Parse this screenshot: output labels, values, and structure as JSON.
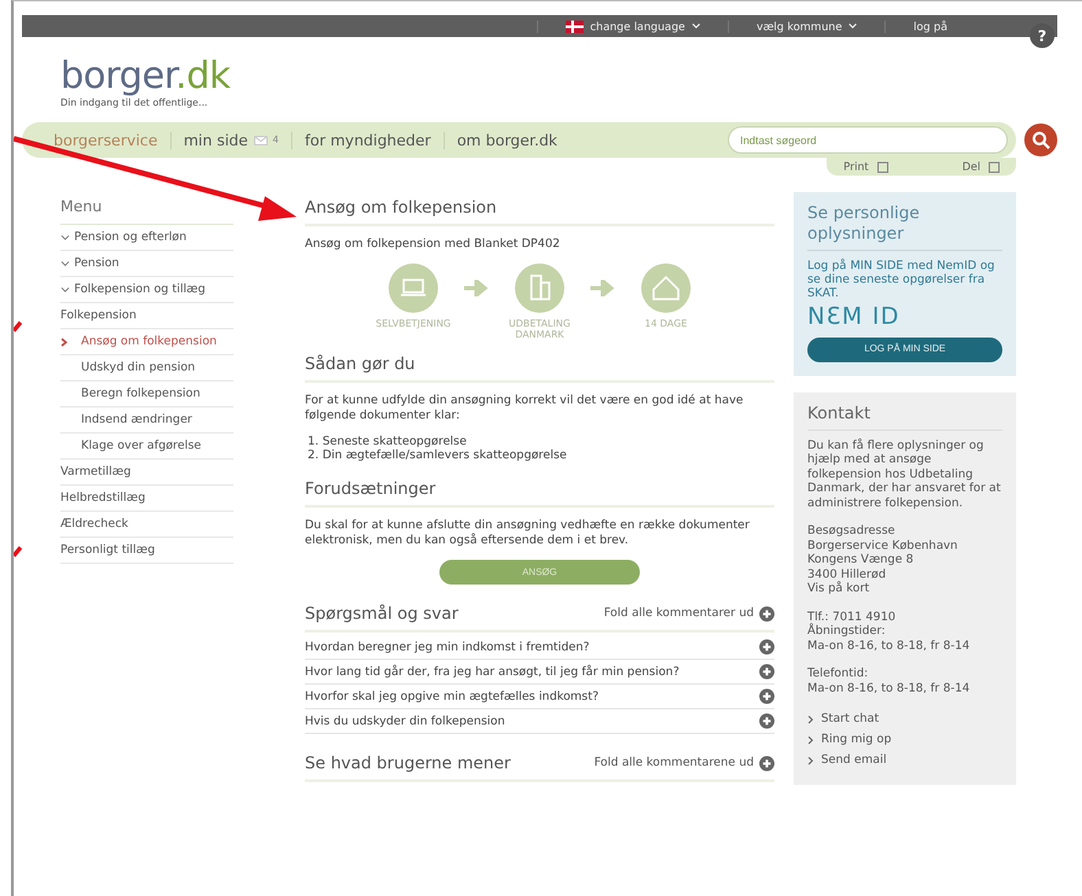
{
  "top_bar": {
    "items": [
      {
        "label": "change language",
        "kind": "flag"
      },
      {
        "label": "vælg kommune",
        "kind": "dropdown"
      },
      {
        "label": "log på",
        "kind": "plain"
      }
    ],
    "help": "?"
  },
  "logo": {
    "text_a": "borger",
    "text_b": ".dk",
    "tagline": "Din indgang til det offentlige..."
  },
  "nav": {
    "items": [
      {
        "label": "borgerservice",
        "selected": true
      },
      {
        "label": "min side",
        "selected": false,
        "badge": "4"
      },
      {
        "label": "for myndigheder",
        "selected": false
      },
      {
        "label": "om borger.dk",
        "selected": false
      }
    ],
    "search": {
      "placeholder": "Indtast søgeord"
    }
  },
  "tools": [
    "Print",
    "Del"
  ],
  "menu": {
    "title": "Menu",
    "items": [
      {
        "label": "Pension og efterløn",
        "kind": "expander",
        "expanded": true
      },
      {
        "label": "Pension",
        "kind": "expander",
        "expanded": true
      },
      {
        "label": "Folkepension og tillæg",
        "kind": "expander",
        "expanded": true
      },
      {
        "label": "Folkepension",
        "kind": "plain",
        "children": [
          {
            "label": "Ansøg om folkepension",
            "selected": true
          },
          {
            "label": "Udskyd din pension",
            "selected": false
          },
          {
            "label": "Beregn folkepension",
            "selected": false
          },
          {
            "label": "Indsend ændringer",
            "selected": false
          },
          {
            "label": "Klage over afgørelse",
            "selected": false
          }
        ]
      },
      {
        "label": "Varmetillæg",
        "kind": "plain"
      },
      {
        "label": "Helbredstillæg",
        "kind": "plain"
      },
      {
        "label": "Ældrecheck",
        "kind": "plain"
      },
      {
        "label": "Personligt tillæg",
        "kind": "plain"
      }
    ]
  },
  "main": {
    "title": "Ansøg om folkepension",
    "intro": "Ansøg om folkepension med Blanket DP402",
    "steps": [
      {
        "label": "SELVBETJENING",
        "kind": "laptop"
      },
      {
        "label": "UDBETALING DANMARK",
        "kind": "building"
      },
      {
        "label": "14 DAGE",
        "kind": "house"
      }
    ],
    "how_title": "Sådan gør du",
    "how_text": "For at kunne udfylde din ansøgning korrekt vil det være en god idé at have følgende dokumenter klar:",
    "how_list": [
      {
        "num": "1.",
        "text": "Seneste skatteopgørelse"
      },
      {
        "num": "2.",
        "text": "Din ægtefælle/samlevers skatteopgørelse"
      }
    ],
    "req_title": "Forudsætninger",
    "req_text": "Du skal for at kunne afslutte din ansøgning vedhæfte en række dokumenter elektronisk, men du kan også eftersende dem i et brev.",
    "apply_button": "ANSØG",
    "faq": {
      "title": "Spørgsmål og svar",
      "fold": "Fold alle kommentarer ud",
      "questions": [
        "Hvordan beregner jeg min indkomst i fremtiden?",
        "Hvor lang tid går der, fra jeg har ansøgt, til jeg får min pension?",
        "Hvorfor skal jeg opgive min ægtefælles indkomst?",
        "Hvis du udskyder din folkepension"
      ]
    },
    "opinions": {
      "title": "Se hvad brugerne mener",
      "fold": "Fold alle kommentarene ud"
    }
  },
  "personal": {
    "title": "Se personlige oplysninger",
    "text": "Log på MIN SIDE med NemID og se dine seneste opgørelser fra SKAT.",
    "nemid": "NƐM ID",
    "button": "LOG PÅ MIN SIDE"
  },
  "contact": {
    "title": "Kontakt",
    "text": "Du kan få flere oplysninger og hjælp med at ansøge folkepension hos Udbetaling Danmark, der har ansvaret for at administrere folkepension.",
    "address": [
      "Besøgsadresse",
      "Borgerservice København",
      "Kongens Vænge 8",
      "3400 Hillerød"
    ],
    "map_link": "Vis på kort",
    "phone": [
      "Tlf.: 7011 4910",
      "Åbningstider:",
      "Ma-on 8-16, to 8-18, fr 8-14"
    ],
    "phone_time": [
      "Telefontid:",
      "Ma-on 8-16, to 8-18, fr 8-14"
    ],
    "links": [
      "Start chat",
      "Ring mig op",
      "Send email"
    ]
  }
}
